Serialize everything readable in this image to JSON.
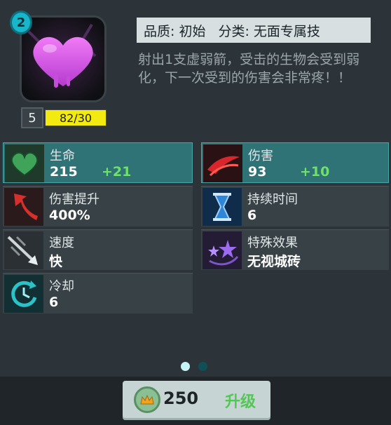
{
  "skill": {
    "level": "2",
    "card_level": "5",
    "xp_text": "82/30",
    "xp_progress": 1.0,
    "quality_label": "品质: 初始",
    "category_label": "分类: 无面专属技",
    "description": "射出1支虚弱箭，受击的生物会受到弱化，下一次受到的伤害会非常疼！！"
  },
  "stats": [
    {
      "name": "生命",
      "value": "215",
      "bonus": "+21",
      "icon": "green-heart-icon",
      "highlight": true
    },
    {
      "name": "伤害",
      "value": "93",
      "bonus": "+10",
      "icon": "red-slash-icon",
      "highlight": true
    },
    {
      "name": "伤害提升",
      "value": "400%",
      "bonus": "",
      "icon": "red-arrow-up-icon",
      "highlight": false
    },
    {
      "name": "持续时间",
      "value": "6",
      "bonus": "",
      "icon": "hourglass-icon",
      "highlight": false
    },
    {
      "name": "速度",
      "value": "快",
      "bonus": "",
      "icon": "arrow-speed-icon",
      "highlight": false
    },
    {
      "name": "特殊效果",
      "value": "无视城砖",
      "bonus": "",
      "icon": "purple-stars-icon",
      "highlight": false
    },
    {
      "name": "冷却",
      "value": "6",
      "bonus": "",
      "icon": "cooldown-clock-icon",
      "highlight": false
    }
  ],
  "pagination": {
    "pages": 2,
    "active": 0
  },
  "upgrade": {
    "cost": "250",
    "label": "升级"
  },
  "colors": {
    "accent_cyan": "#19b5c9",
    "highlight_row": "#2f7377",
    "bonus_green": "#6fe06a",
    "xp_yellow": "#f2ea10",
    "heart_pink": "#d94be8"
  }
}
